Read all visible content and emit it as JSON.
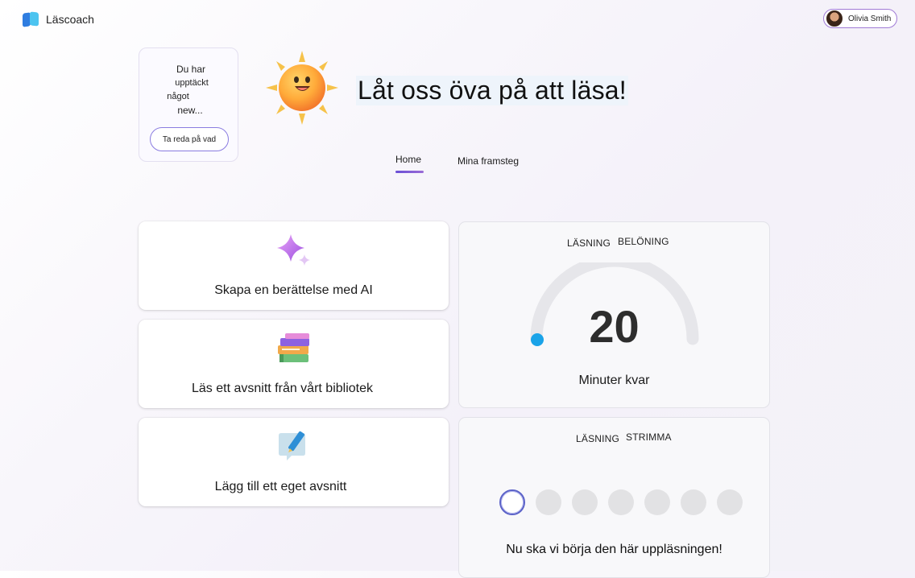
{
  "app": {
    "name": "Läscoach",
    "logo_icon": "book-logo-icon"
  },
  "user": {
    "name": "Olivia Smith",
    "avatar_icon": "user-avatar-icon"
  },
  "notice": {
    "line1": "Du har",
    "line2": "upptäckt",
    "line3": "något",
    "line4": "new...",
    "button": "Ta reda på vad"
  },
  "hero": {
    "title": "Låt oss öva på att läsa!",
    "mascot_icon": "sun-mascot-icon"
  },
  "tabs": [
    {
      "label": "Home",
      "active": true
    },
    {
      "label": "Mina framsteg",
      "active": false
    }
  ],
  "actions": [
    {
      "label": "Skapa en berättelse med AI",
      "icon": "sparkle-icon"
    },
    {
      "label": "Läs ett avsnitt från vårt bibliotek",
      "icon": "books-stack-icon"
    },
    {
      "label": "Lägg till ett eget avsnitt",
      "icon": "pen-note-icon"
    }
  ],
  "reading_reward": {
    "tab1": "LÄSNING",
    "tab2": "BELÖNING",
    "minutes_left": "20",
    "caption": "Minuter kvar",
    "progress_fraction": 0.0,
    "colors": {
      "track": "#e6e6ea",
      "fill": "#1aa3e8"
    }
  },
  "reading_streak": {
    "tab1": "LÄSNING",
    "tab2": "STRIMMA",
    "days_total": 7,
    "days_active": 1,
    "caption": "Nu ska vi börja den här uppläsningen!"
  },
  "colors": {
    "accent": "#6a4fd6",
    "streak_ring": "#5b62c8"
  }
}
